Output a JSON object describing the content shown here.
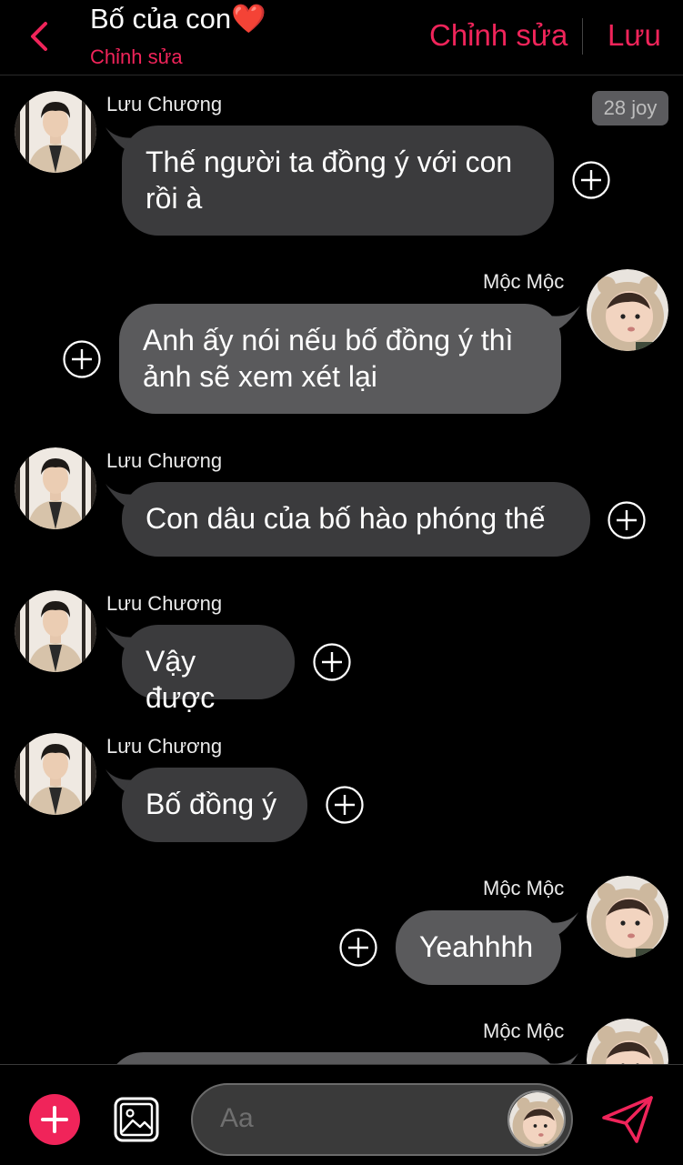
{
  "header": {
    "title": "Bố của con",
    "title_emoji": "❤️",
    "subtitle": "Chỉnh sửa",
    "edit_label": "Chỉnh sửa",
    "save_label": "Lưu"
  },
  "time_badge": "28 joy",
  "messages": [
    {
      "sender": "Lưu Chương",
      "side": "left",
      "text_lines": [
        "Thế người ta đồng ý với con",
        "rồi à"
      ]
    },
    {
      "sender": "Mộc Mộc",
      "side": "right",
      "text_lines": [
        "Anh ấy nói nếu bố đồng ý thì",
        "ảnh sẽ xem xét lại"
      ]
    },
    {
      "sender": "Lưu Chương",
      "side": "left",
      "text_lines": [
        "Con dâu của bố hào phóng thế"
      ]
    },
    {
      "sender": "Lưu Chương",
      "side": "left",
      "text_lines": [
        "Vậy được"
      ]
    },
    {
      "sender": "Lưu Chương",
      "side": "left",
      "text_lines": [
        "Bố đồng ý"
      ]
    },
    {
      "sender": "Mộc Mộc",
      "side": "right",
      "text_lines": [
        "Yeahhhh"
      ]
    },
    {
      "sender": "Mộc Mộc",
      "side": "right",
      "text_lines": []
    }
  ],
  "composer": {
    "placeholder": "Aa"
  },
  "icons": {
    "back": "chevron-left-icon",
    "add_message": "plus-circle-icon",
    "composer_add": "plus-icon",
    "image": "image-icon",
    "send": "send-icon"
  },
  "colors": {
    "accent": "#f0245a",
    "bubble_left": "#3b3b3d",
    "bubble_right": "#5a5a5c",
    "background": "#000000"
  }
}
